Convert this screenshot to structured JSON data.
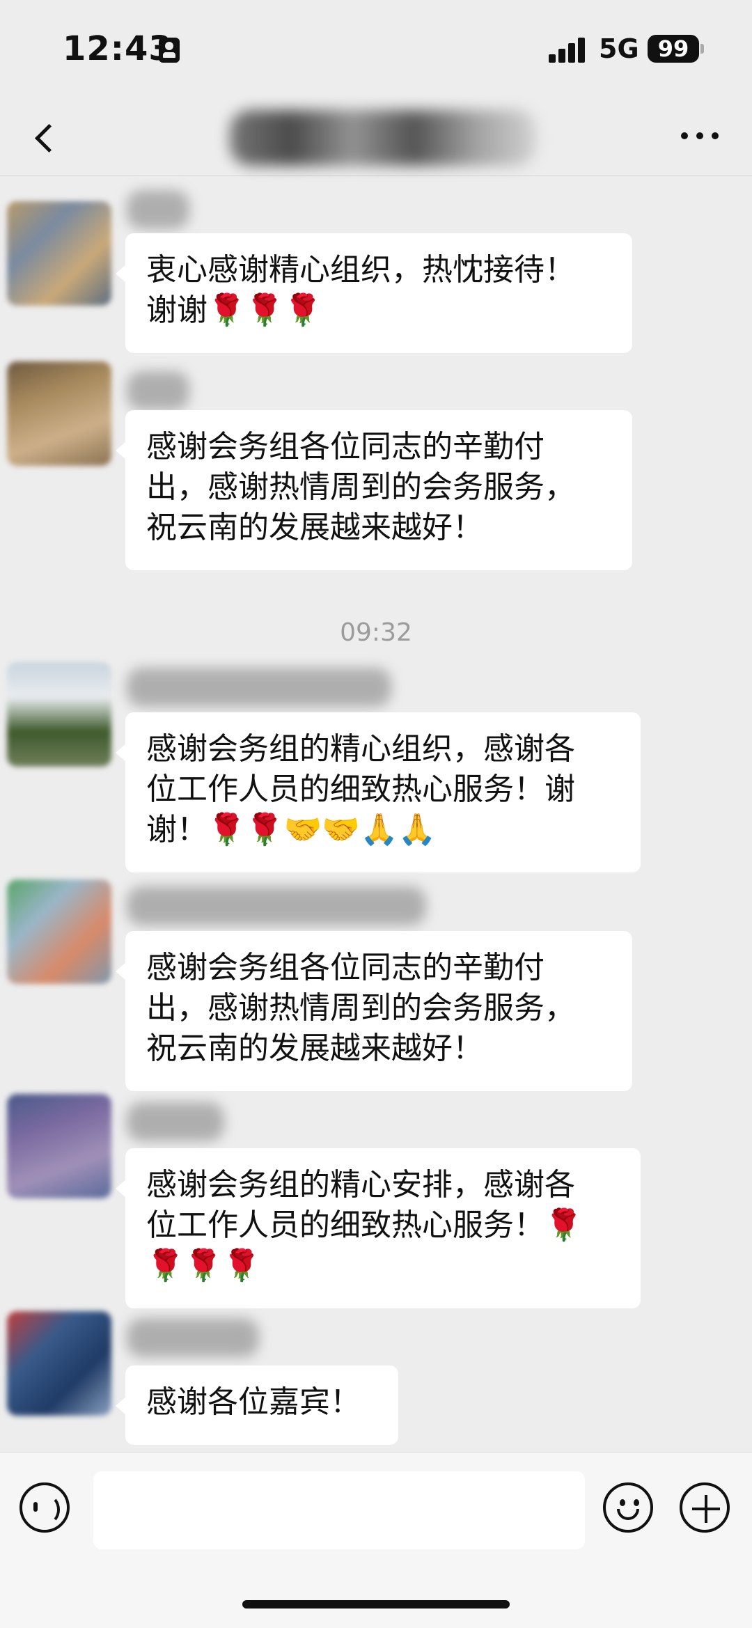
{
  "status_bar": {
    "time": "12:43",
    "network": "5G",
    "battery": "99"
  },
  "nav": {
    "title": ""
  },
  "timestamp": "09:32",
  "messages": [
    {
      "text_lines": [
        "衷心感谢精心组织，热忱接待！",
        "谢谢🌹🌹🌹"
      ]
    },
    {
      "text_lines": [
        "感谢会务组各位同志的辛勤付",
        "出，感谢热情周到的会务服务，",
        "祝云南的发展越来越好！"
      ]
    },
    {
      "text_lines": [
        "感谢会务组的精心组织，感谢各",
        "位工作人员的细致热心服务！谢",
        "谢！🌹🌹🤝🤝🙏🙏"
      ]
    },
    {
      "text_lines": [
        "感谢会务组各位同志的辛勤付",
        "出，感谢热情周到的会务服务，",
        "祝云南的发展越来越好！"
      ]
    },
    {
      "text_lines": [
        "感谢会务组的精心安排，感谢各",
        "位工作人员的细致热心服务！🌹",
        "🌹🌹🌹"
      ]
    },
    {
      "text_lines": [
        "感谢各位嘉宾！"
      ]
    }
  ],
  "colors": {
    "background": "#ededed",
    "bubble": "#ffffff",
    "timestamp": "#9b9b9b"
  },
  "icons": [
    "back-icon",
    "more-icon",
    "voice-icon",
    "emoji-icon",
    "plus-icon"
  ]
}
